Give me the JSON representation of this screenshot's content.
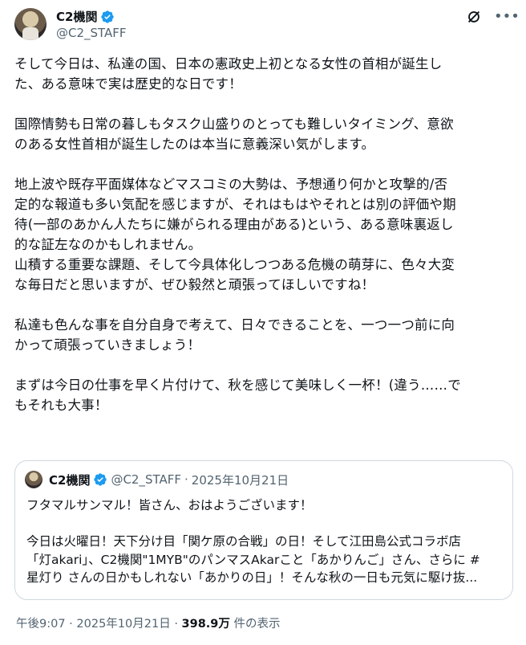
{
  "author": {
    "name": "C2機関",
    "handle": "@C2_STAFF"
  },
  "tweet": {
    "paragraphs": [
      "そして今日は、私達の国、日本の憲政史上初となる女性の首相が誕生し\nた、ある意味で実は歴史的な日です！",
      "国際情勢も日常の暮しもタスク山盛りのとっても難しいタイミング、意欲\nのある女性首相が誕生したのは本当に意義深い気がします。",
      "地上波や既存平面媒体などマスコミの大勢は、予想通り何かと攻撃的/否\n定的な報道も多い気配を感じますが、それはもはやそれとは別の評価や期\n待(一部のあかん人たちに嫌がられる理由がある)という、ある意味裏返し\n的な証左なのかもしれません。\n山積する重要な課題、そして今具体化しつつある危機の萌芽に、色々大変\nな毎日だと思いますが、ぜひ毅然と頑張ってほしいですね！",
      "私達も色んな事を自分自身で考えて、日々できることを、一つ一つ前に向\nかって頑張っていきましょう！",
      "まずは今日の仕事を早く片付けて、秋を感じて美味しく一杯！(違う……で\nもそれも大事！"
    ]
  },
  "quote": {
    "name": "C2機関",
    "handle": "@C2_STAFF",
    "dot": "·",
    "date": "2025年10月21日",
    "line1": "フタマルサンマル！皆さん、おはようございます！",
    "line2": "今日は火曜日！天下分け目「関ケ原の合戦」の日！そして江田島公式コラボ店",
    "line3": "「灯akari」、C2機関\"1MYB\"のパンマスAkarこと「あかりんご」さん、さらに #",
    "line4": "星灯り さんの日かもしれない「あかりの日」！そんな秋の一日も元気に駆け抜..."
  },
  "footer": {
    "time": "午後9:07",
    "dot": "·",
    "date": "2025年10月21日",
    "dot2": "·",
    "views": "398.9万",
    "views_label": " 件の表示"
  },
  "colors": {
    "verified": "#1d9bf0",
    "text": "#0f1419",
    "muted": "#536471",
    "border": "#cfd9de"
  },
  "icons": [
    "verified-badge-icon",
    "grok-icon",
    "more-options-icon"
  ]
}
